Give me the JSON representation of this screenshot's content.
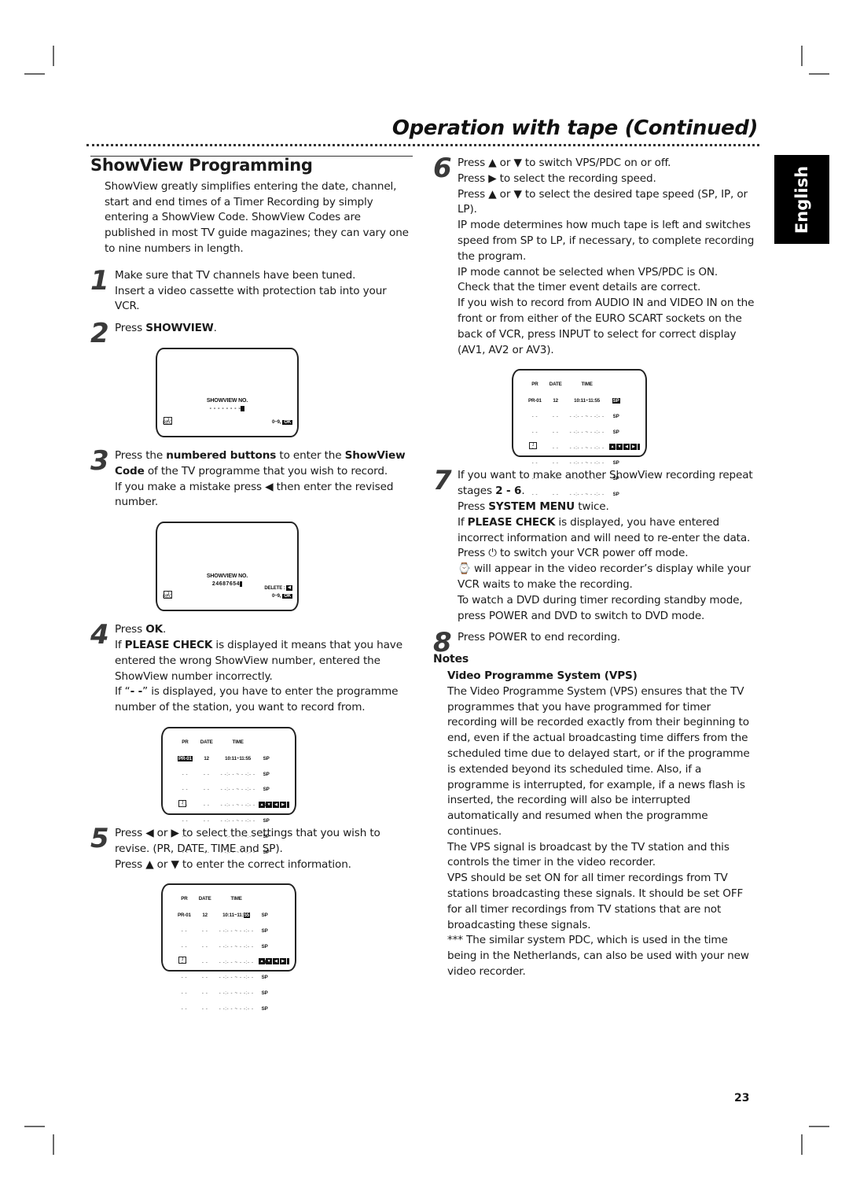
{
  "header": {
    "title": "Operation with tape (Continued)",
    "language_tab": "English"
  },
  "left": {
    "section_title": "ShowView Programming",
    "intro": "ShowView greatly simplifies entering the date, channel, start and end times of a Timer Recording by simply entering a ShowView Code. ShowView Codes are published in most TV guide magazines; they can vary one to nine numbers in length.",
    "steps": [
      {
        "num": "1",
        "lines": [
          "Make sure that TV channels have been tuned.",
          "Insert a video cassette with protection tab into your VCR."
        ]
      },
      {
        "num": "2",
        "pre": "Press ",
        "bold": "SHOWVIEW",
        "post": "."
      },
      {
        "num": "3",
        "a_pre": "Press the ",
        "a_bold1": "numbered buttons",
        "a_mid": " to enter the ",
        "a_bold2": "ShowView Code",
        "a_post": " of the TV programme that you wish to record.",
        "b": "If you make a mistake press ◀ then enter the revised number."
      },
      {
        "num": "4",
        "a_pre": "Press ",
        "a_bold": "OK",
        "a_post": ".",
        "b_pre": "If ",
        "b_bold": "PLEASE CHECK",
        "b_post": " is displayed it means that you have entered the wrong ShowView number, entered the ShowView number incorrectly.",
        "c_pre": "If “",
        "c_bold": "- -",
        "c_post": "” is displayed, you have to enter the programme number of the station, you want to record from."
      },
      {
        "num": "5",
        "a": "Press ◀  or ▶ to select the settings that you wish to revise. (PR, DATE, TIME and SP).",
        "b": "Press ▲  or ▼ to enter the correct information."
      }
    ]
  },
  "osd_showview_empty": {
    "label": "SHOWVIEW NO.",
    "value": "- - - - - - - -",
    "rec_label": "REC",
    "hint": "0~9,",
    "ok": "OK"
  },
  "osd_showview_filled": {
    "label": "SHOWVIEW NO.",
    "value": "24687654",
    "rec_label": "REC",
    "delete_hint": "DELETE :",
    "hint": "0~9,",
    "ok": "OK"
  },
  "timer_table": {
    "headers": [
      "PR",
      "DATE",
      "TIME",
      ""
    ],
    "first_row": {
      "pr": "PR-01",
      "date": "12",
      "time": "10:11~11:55",
      "speed": "SP"
    },
    "empty_row": {
      "pr": "- -",
      "date": "- -",
      "time": "- -:- - ~ - -:- -",
      "speed": "SP"
    },
    "empty_rows": 6
  },
  "right": {
    "step6": {
      "num": "6",
      "lines": [
        "Press ▲  or ▼ to switch VPS/PDC on or off.",
        "Press ▶  to select the recording speed.",
        "Press ▲  or ▼ to select the desired tape speed (SP, IP, or LP).",
        "IP mode determines how much tape is left and switches speed from SP to LP, if necessary, to  complete recording the program.",
        "IP mode cannot be selected when VPS/PDC is ON.",
        "Check that the timer event details are correct.",
        "If you wish to record from AUDIO IN and VIDEO IN on the front or from either of the EURO SCART sockets on the back of VCR, press INPUT to select for correct display (AV1, AV2 or AV3)."
      ]
    },
    "step7": {
      "num": "7",
      "a_pre": "If you want to make another ShowView recording repeat stages ",
      "a_bold": "2 - 6",
      "a_post": ".",
      "b_pre": "Press ",
      "b_bold": "SYSTEM MENU",
      "b_post": " twice.",
      "c_pre": "If ",
      "c_bold": "PLEASE CHECK",
      "c_post": " is displayed, you have entered incorrect information and will need to re-enter the data.",
      "d": "Press ⏻ to switch your VCR power off mode.",
      "e": "⌚ will appear in the video recorder’s display while your VCR waits to make the recording.",
      "f": "To watch a DVD during timer recording standby mode, press POWER and DVD to switch to DVD mode."
    },
    "step8": {
      "num": "8",
      "text": "Press POWER to end recording."
    },
    "notes": {
      "title": "Notes",
      "subtitle": "Video Programme System (VPS)",
      "paragraphs": [
        "The Video Programme System (VPS) ensures that the TV programmes that you have programmed for timer recording will be recorded exactly from their beginning to end, even if the actual broadcasting time differs from the scheduled time due to delayed start, or if the programme is extended beyond its scheduled time. Also, if a programme is interrupted, for example, if a news flash is inserted, the recording will also be interrupted automatically and resumed when the programme continues.",
        "The VPS signal is broadcast by the TV station and this controls the timer in the video recorder.",
        "VPS should be set ON for all timer recordings from TV stations broadcasting these signals. It should be set OFF for all timer recordings from TV stations that are not broadcasting these signals.",
        "*** The similar system PDC, which is used in the time being in the Netherlands, can also be used with your new video recorder."
      ]
    }
  },
  "footer": {
    "page_number": "23"
  }
}
